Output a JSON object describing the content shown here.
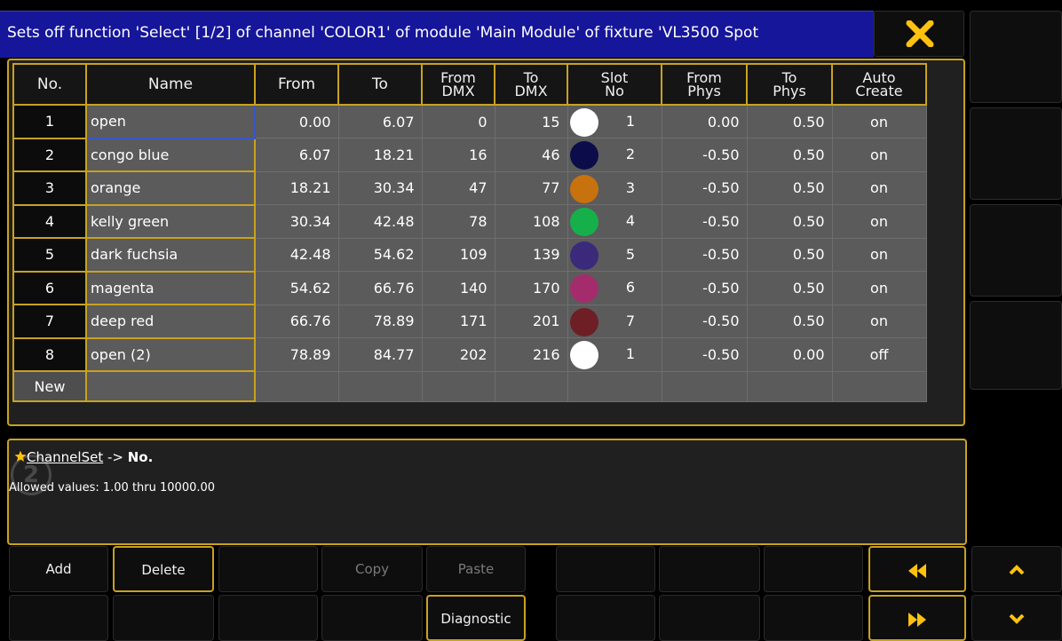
{
  "title": "Sets off function 'Select' [1/2] of channel 'COLOR1' of module 'Main Module' of fixture 'VL3500 Spot",
  "close_icon": "close-icon",
  "headers": [
    {
      "line1": "No.",
      "line2": ""
    },
    {
      "line1": "Name",
      "line2": ""
    },
    {
      "line1": "From",
      "line2": ""
    },
    {
      "line1": "To",
      "line2": ""
    },
    {
      "line1": "From",
      "line2": "DMX"
    },
    {
      "line1": "To",
      "line2": "DMX"
    },
    {
      "line1": "Slot",
      "line2": "No"
    },
    {
      "line1": "From",
      "line2": "Phys"
    },
    {
      "line1": "To",
      "line2": "Phys"
    },
    {
      "line1": "Auto",
      "line2": "Create"
    }
  ],
  "rows": [
    {
      "no": "1",
      "name": "open",
      "from": "0.00",
      "to": "6.07",
      "from_dmx": "0",
      "to_dmx": "15",
      "color": "#ffffff",
      "slot": "1",
      "from_phys": "0.00",
      "to_phys": "0.50",
      "auto": "on"
    },
    {
      "no": "2",
      "name": "congo blue",
      "from": "6.07",
      "to": "18.21",
      "from_dmx": "16",
      "to_dmx": "46",
      "color": "#0c0c4a",
      "slot": "2",
      "from_phys": "-0.50",
      "to_phys": "0.50",
      "auto": "on"
    },
    {
      "no": "3",
      "name": "orange",
      "from": "18.21",
      "to": "30.34",
      "from_dmx": "47",
      "to_dmx": "77",
      "color": "#c8720e",
      "slot": "3",
      "from_phys": "-0.50",
      "to_phys": "0.50",
      "auto": "on"
    },
    {
      "no": "4",
      "name": "kelly green",
      "from": "30.34",
      "to": "42.48",
      "from_dmx": "78",
      "to_dmx": "108",
      "color": "#16b04a",
      "slot": "4",
      "from_phys": "-0.50",
      "to_phys": "0.50",
      "auto": "on"
    },
    {
      "no": "5",
      "name": "dark fuchsia",
      "from": "42.48",
      "to": "54.62",
      "from_dmx": "109",
      "to_dmx": "139",
      "color": "#3b2a7a",
      "slot": "5",
      "from_phys": "-0.50",
      "to_phys": "0.50",
      "auto": "on"
    },
    {
      "no": "6",
      "name": "magenta",
      "from": "54.62",
      "to": "66.76",
      "from_dmx": "140",
      "to_dmx": "170",
      "color": "#a42c6c",
      "slot": "6",
      "from_phys": "-0.50",
      "to_phys": "0.50",
      "auto": "on"
    },
    {
      "no": "7",
      "name": "deep red",
      "from": "66.76",
      "to": "78.89",
      "from_dmx": "171",
      "to_dmx": "201",
      "color": "#6e1f26",
      "slot": "7",
      "from_phys": "-0.50",
      "to_phys": "0.50",
      "auto": "on"
    },
    {
      "no": "8",
      "name": "open (2)",
      "from": "78.89",
      "to": "84.77",
      "from_dmx": "202",
      "to_dmx": "216",
      "color": "#ffffff",
      "slot": "1",
      "from_phys": "-0.50",
      "to_phys": "0.00",
      "auto": "off"
    }
  ],
  "new_row_label": "New",
  "info": {
    "star_icon": "star-icon",
    "link": "ChannelSet",
    "arrow": " -> ",
    "field": "No.",
    "allowed": "Allowed values: 1.00 thru 10000.00"
  },
  "buttons": {
    "add": "Add",
    "delete": "Delete",
    "copy": "Copy",
    "paste": "Paste",
    "diagnostic": "Diagnostic"
  },
  "colors": {
    "accent": "#c9a21e",
    "title_bg": "#16169a",
    "cell_bg": "#5b5b5b",
    "close_x": "#ffc20e",
    "arrows": "#ffc20e"
  }
}
